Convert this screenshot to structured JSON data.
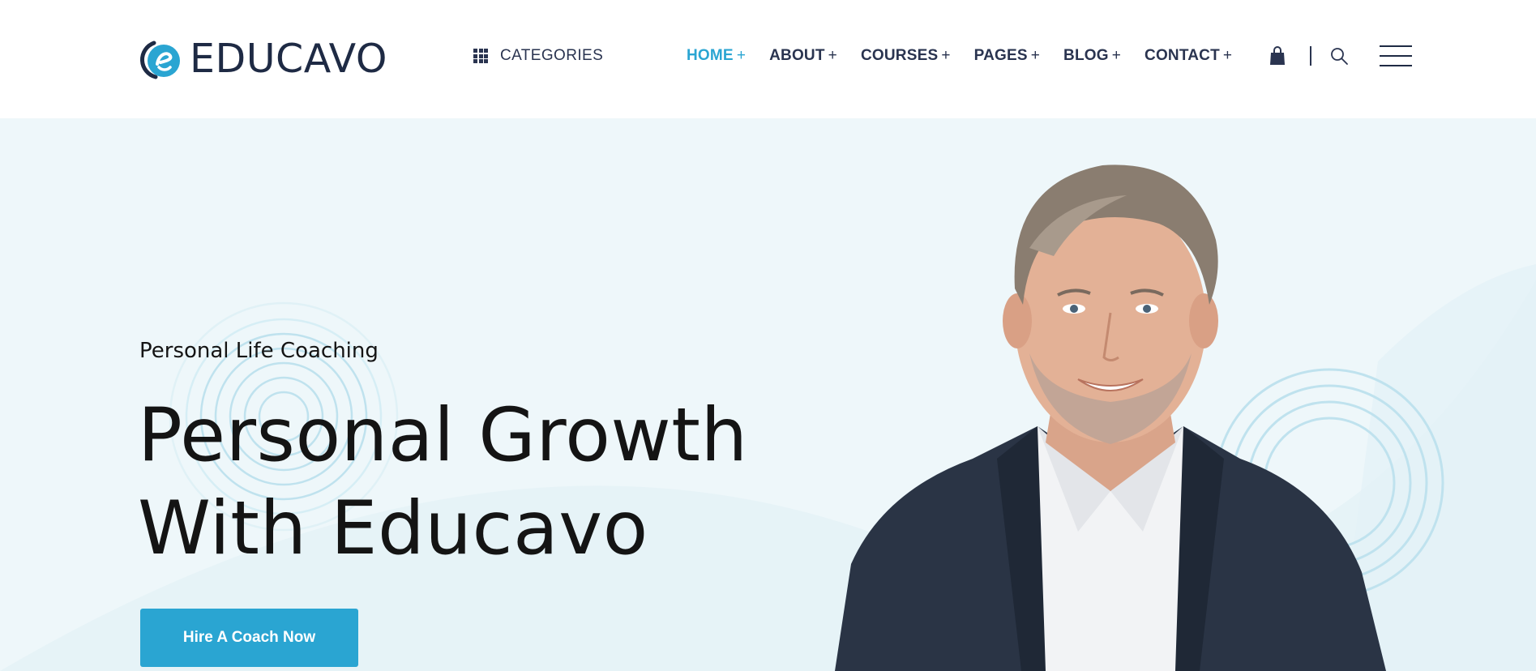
{
  "brand": {
    "name": "EDUCAVO",
    "accent_color": "#2aa5d2",
    "dark_color": "#1e2a44"
  },
  "header": {
    "categories_label": "CATEGORIES",
    "categories_icon": "grid-icon",
    "nav": [
      {
        "label": "HOME",
        "suffix": "+",
        "active": true
      },
      {
        "label": "ABOUT",
        "suffix": "+",
        "active": false
      },
      {
        "label": "COURSES",
        "suffix": "+",
        "active": false
      },
      {
        "label": "PAGES",
        "suffix": "+",
        "active": false
      },
      {
        "label": "BLOG",
        "suffix": "+",
        "active": false
      },
      {
        "label": "CONTACT",
        "suffix": "+",
        "active": false
      }
    ],
    "icons": [
      "shopping-bag-icon",
      "search-icon",
      "hamburger-menu-icon"
    ]
  },
  "hero": {
    "eyebrow": "Personal Life Coaching",
    "title_line_1": "Personal Growth",
    "title_line_2": "With Educavo",
    "cta_label": "Hire A Coach Now",
    "background_color": "#eef7fa",
    "image": "smiling-man-in-suit-portrait"
  }
}
